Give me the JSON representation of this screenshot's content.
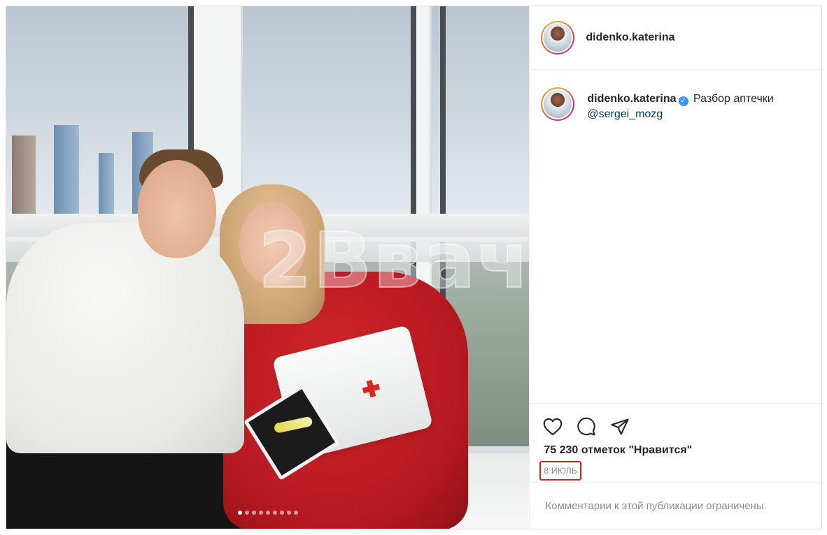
{
  "post": {
    "username": "didenko.katerina",
    "caption": {
      "username": "didenko.katerina",
      "verified_icon": "verified-badge-icon",
      "text": "Разбор аптечки",
      "mention": "@sergei_mozg"
    },
    "likes": "75 230 отметок \"Нравится\"",
    "date": "8 ИЮЛЬ",
    "comments_disabled": "Комментарии к этой публикации ограничены.",
    "carousel": {
      "total": 9,
      "active_index": 0
    },
    "watermark": "2Ввач",
    "colors": {
      "like_stroke": "#262626",
      "link": "#00376b",
      "highlight_box": "#e01b1b",
      "verified": "#3897f0"
    }
  }
}
